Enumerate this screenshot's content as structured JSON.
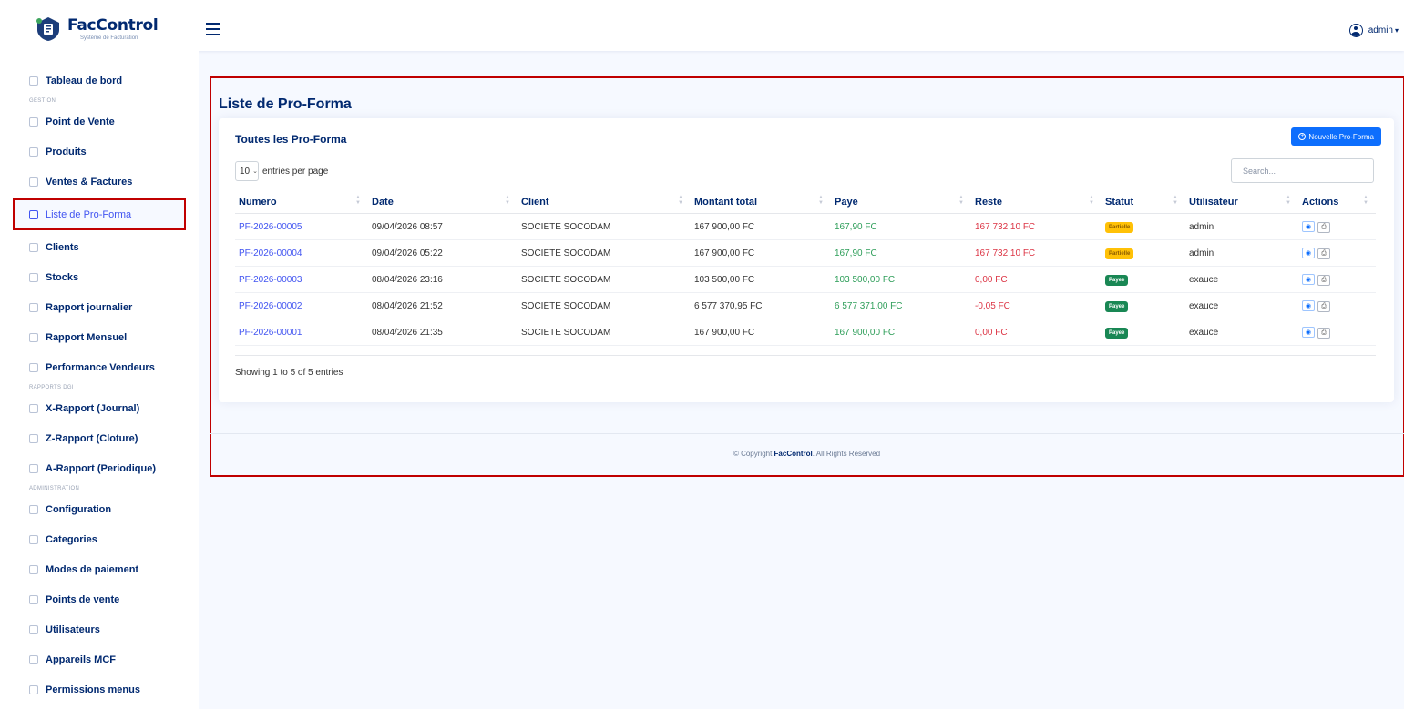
{
  "header": {
    "logo_title": "FacControl",
    "logo_subtitle": "Système de Facturation",
    "user": "admin"
  },
  "sidebar": {
    "items": [
      {
        "type": "item",
        "label": "Tableau de bord"
      },
      {
        "type": "heading",
        "label": "GESTION"
      },
      {
        "type": "item",
        "label": "Point de Vente"
      },
      {
        "type": "item",
        "label": "Produits"
      },
      {
        "type": "item",
        "label": "Ventes & Factures"
      },
      {
        "type": "item",
        "label": "Liste de Pro-Forma",
        "active": true
      },
      {
        "type": "item",
        "label": "Clients"
      },
      {
        "type": "item",
        "label": "Stocks"
      },
      {
        "type": "item",
        "label": "Rapport journalier"
      },
      {
        "type": "item",
        "label": "Rapport Mensuel"
      },
      {
        "type": "item",
        "label": "Performance Vendeurs"
      },
      {
        "type": "heading",
        "label": "RAPPORTS DGI"
      },
      {
        "type": "item",
        "label": "X-Rapport (Journal)"
      },
      {
        "type": "item",
        "label": "Z-Rapport (Cloture)"
      },
      {
        "type": "item",
        "label": "A-Rapport (Periodique)"
      },
      {
        "type": "heading",
        "label": "ADMINISTRATION"
      },
      {
        "type": "item",
        "label": "Configuration"
      },
      {
        "type": "item",
        "label": "Categories"
      },
      {
        "type": "item",
        "label": "Modes de paiement"
      },
      {
        "type": "item",
        "label": "Points de vente"
      },
      {
        "type": "item",
        "label": "Utilisateurs"
      },
      {
        "type": "item",
        "label": "Appareils MCF"
      },
      {
        "type": "item",
        "label": "Permissions menus"
      }
    ]
  },
  "page": {
    "title": "Liste de Pro-Forma",
    "card_title": "Toutes les Pro-Forma",
    "new_button": "Nouvelle Pro-Forma",
    "per_page_value": "10",
    "per_page_label": "entries per page",
    "search_placeholder": "Search...",
    "info": "Showing 1 to 5 of 5 entries"
  },
  "table": {
    "columns": [
      "Numero",
      "Date",
      "Client",
      "Montant total",
      "Paye",
      "Reste",
      "Statut",
      "Utilisateur",
      "Actions"
    ],
    "rows": [
      {
        "numero": "PF-2026-00005",
        "date": "09/04/2026 08:57",
        "client": "SOCIETE SOCODAM",
        "montant": "167 900,00 FC",
        "paye": "167,90 FC",
        "reste": "167 732,10 FC",
        "statut": "Partielle",
        "statut_type": "partial",
        "utilisateur": "admin"
      },
      {
        "numero": "PF-2026-00004",
        "date": "09/04/2026 05:22",
        "client": "SOCIETE SOCODAM",
        "montant": "167 900,00 FC",
        "paye": "167,90 FC",
        "reste": "167 732,10 FC",
        "statut": "Partielle",
        "statut_type": "partial",
        "utilisateur": "admin"
      },
      {
        "numero": "PF-2026-00003",
        "date": "08/04/2026 23:16",
        "client": "SOCIETE SOCODAM",
        "montant": "103 500,00 FC",
        "paye": "103 500,00 FC",
        "reste": "0,00 FC",
        "statut": "Payee",
        "statut_type": "paid",
        "utilisateur": "exauce"
      },
      {
        "numero": "PF-2026-00002",
        "date": "08/04/2026 21:52",
        "client": "SOCIETE SOCODAM",
        "montant": "6 577 370,95 FC",
        "paye": "6 577 371,00 FC",
        "reste": "-0,05 FC",
        "statut": "Payee",
        "statut_type": "paid",
        "utilisateur": "exauce"
      },
      {
        "numero": "PF-2026-00001",
        "date": "08/04/2026 21:35",
        "client": "SOCIETE SOCODAM",
        "montant": "167 900,00 FC",
        "paye": "167 900,00 FC",
        "reste": "0,00 FC",
        "statut": "Payee",
        "statut_type": "paid",
        "utilisateur": "exauce"
      }
    ]
  },
  "footer": {
    "prefix": "© Copyright",
    "brand": "FacControl",
    "suffix": "All Rights Reserved"
  }
}
